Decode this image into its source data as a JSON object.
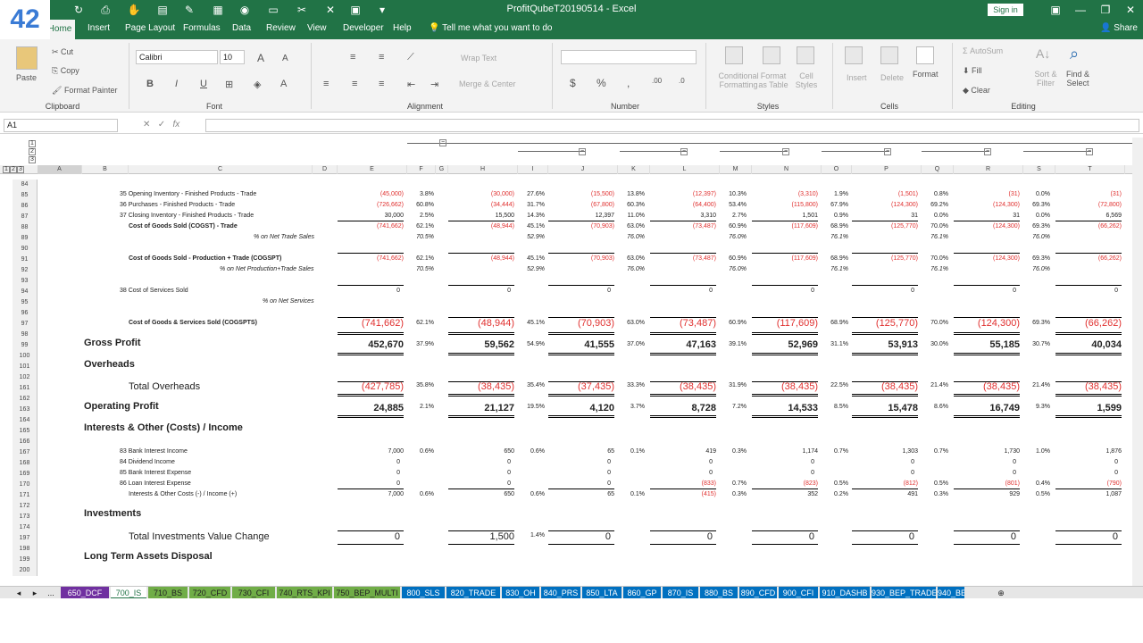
{
  "window": {
    "title": "ProfitQubeT20190514  -  Excel",
    "signin": "Sign in",
    "logo": "42"
  },
  "ribbon_tabs": [
    "Home",
    "Insert",
    "Page Layout",
    "Formulas",
    "Data",
    "Review",
    "View",
    "Developer",
    "Help"
  ],
  "tell_me": "Tell me what you want to do",
  "share": "Share",
  "clipboard": {
    "paste": "Paste",
    "cut": "Cut",
    "copy": "Copy",
    "format_painter": "Format Painter",
    "label": "Clipboard"
  },
  "font": {
    "name": "Calibri",
    "size": "10",
    "label": "Font"
  },
  "alignment": {
    "wrap": "Wrap Text",
    "merge": "Merge & Center",
    "label": "Alignment"
  },
  "number": {
    "label": "Number"
  },
  "styles": {
    "cond": "Conditional Formatting",
    "fmt_table": "Format as Table",
    "cell_styles": "Cell Styles",
    "label": "Styles"
  },
  "cells": {
    "insert": "Insert",
    "delete": "Delete",
    "format": "Format",
    "label": "Cells"
  },
  "editing": {
    "autosum": "AutoSum",
    "fill": "Fill",
    "clear": "Clear",
    "sort": "Sort & Filter",
    "find": "Find & Select",
    "label": "Editing"
  },
  "formula_bar": {
    "name_box": "A1",
    "fx": "fx",
    "value": ""
  },
  "outline_levels": [
    "1",
    "2",
    "3"
  ],
  "columns": [
    "A",
    "B",
    "C",
    "D",
    "E",
    "F",
    "G",
    "H",
    "I",
    "J",
    "K",
    "L",
    "M",
    "N",
    "O",
    "P",
    "Q",
    "R",
    "S",
    "T"
  ],
  "rows": [
    "84",
    "85",
    "86",
    "87",
    "88",
    "89",
    "90",
    "91",
    "92",
    "93",
    "94",
    "95",
    "96",
    "97",
    "98",
    "99",
    "100",
    "101",
    "102",
    "161",
    "162",
    "163",
    "164",
    "165",
    "166",
    "167",
    "168",
    "169",
    "170",
    "171",
    "172",
    "173",
    "174",
    "197",
    "198",
    "199",
    "200"
  ],
  "sheet": {
    "r85": {
      "label": "35  Opening Inventory - Finished Products - Trade",
      "v": [
        "(45,000)",
        "3.8%",
        "(30,000)",
        "27.6%",
        "(15,500)",
        "13.8%",
        "(12,397)",
        "10.3%",
        "(3,310)",
        "1.9%",
        "(1,501)",
        "0.8%",
        "(31)",
        "0.0%",
        "(31)"
      ]
    },
    "r86": {
      "label": "36  Purchases - Finished Products - Trade",
      "v": [
        "(726,662)",
        "60.8%",
        "(34,444)",
        "31.7%",
        "(67,800)",
        "60.3%",
        "(64,400)",
        "53.4%",
        "(115,800)",
        "67.9%",
        "(124,300)",
        "69.2%",
        "(124,300)",
        "69.3%",
        "(72,800)"
      ]
    },
    "r87": {
      "label": "37  Closing Inventory - Finished Products - Trade",
      "v": [
        "30,000",
        "2.5%",
        "15,500",
        "14.3%",
        "12,397",
        "11.0%",
        "3,310",
        "2.7%",
        "1,501",
        "0.9%",
        "31",
        "0.0%",
        "31",
        "0.0%",
        "6,569"
      ]
    },
    "r88": {
      "label": "Cost of Goods Sold  (COGST) - Trade",
      "v": [
        "(741,662)",
        "62.1%",
        "(48,944)",
        "45.1%",
        "(70,903)",
        "63.0%",
        "(73,487)",
        "60.9%",
        "(117,609)",
        "68.9%",
        "(125,770)",
        "70.0%",
        "(124,300)",
        "69.3%",
        "(66,262)"
      ]
    },
    "r89": {
      "label": "% on Net Trade Sales",
      "v": [
        "70.5%",
        "52.9%",
        "76.0%",
        "76.0%",
        "76.1%",
        "76.1%",
        "76.0%"
      ]
    },
    "r91": {
      "label": "Cost of Goods Sold - Production + Trade (COGSPT)",
      "v": [
        "(741,662)",
        "62.1%",
        "(48,944)",
        "45.1%",
        "(70,903)",
        "63.0%",
        "(73,487)",
        "60.9%",
        "(117,609)",
        "68.9%",
        "(125,770)",
        "70.0%",
        "(124,300)",
        "69.3%",
        "(66,262)"
      ]
    },
    "r92": {
      "label": "% on Net Production+Trade Sales",
      "v": [
        "70.5%",
        "52.9%",
        "76.0%",
        "76.0%",
        "76.1%",
        "76.1%",
        "76.0%"
      ]
    },
    "r94": {
      "label": "38  Cost of Services Sold",
      "v": [
        "0",
        "0",
        "0",
        "0",
        "0",
        "0",
        "0",
        "0"
      ]
    },
    "r95": {
      "label": "% on Net Services"
    },
    "r97": {
      "label": "Cost of Goods & Services Sold (COGSPTS)",
      "v": [
        "(741,662)",
        "62.1%",
        "(48,944)",
        "45.1%",
        "(70,903)",
        "63.0%",
        "(73,487)",
        "60.9%",
        "(117,609)",
        "68.9%",
        "(125,770)",
        "70.0%",
        "(124,300)",
        "69.3%",
        "(66,262)"
      ]
    },
    "r99": {
      "label": "Gross Profit",
      "v": [
        "452,670",
        "37.9%",
        "59,562",
        "54.9%",
        "41,555",
        "37.0%",
        "47,163",
        "39.1%",
        "52,969",
        "31.1%",
        "53,913",
        "30.0%",
        "55,185",
        "30.7%",
        "40,034"
      ]
    },
    "r101": {
      "label": "Overheads"
    },
    "r161": {
      "label": "Total Overheads",
      "v": [
        "(427,785)",
        "35.8%",
        "(38,435)",
        "35.4%",
        "(37,435)",
        "33.3%",
        "(38,435)",
        "31.9%",
        "(38,435)",
        "22.5%",
        "(38,435)",
        "21.4%",
        "(38,435)",
        "21.4%",
        "(38,435)"
      ]
    },
    "r163": {
      "label": "Operating Profit",
      "v": [
        "24,885",
        "2.1%",
        "21,127",
        "19.5%",
        "4,120",
        "3.7%",
        "8,728",
        "7.2%",
        "14,533",
        "8.5%",
        "15,478",
        "8.6%",
        "16,749",
        "9.3%",
        "1,599"
      ]
    },
    "r165": {
      "label": "Interests & Other (Costs) / Income"
    },
    "r167": {
      "label": "83  Bank Interest Income",
      "v": [
        "7,000",
        "0.6%",
        "650",
        "0.6%",
        "65",
        "0.1%",
        "419",
        "0.3%",
        "1,174",
        "0.7%",
        "1,303",
        "0.7%",
        "1,730",
        "1.0%",
        "1,876"
      ]
    },
    "r168": {
      "label": "84  Dividend Income",
      "v": [
        "0",
        "0",
        "0",
        "0",
        "0",
        "0",
        "0",
        "0"
      ]
    },
    "r169": {
      "label": "85  Bank Interest Expense",
      "v": [
        "0",
        "0",
        "0",
        "0",
        "0",
        "0",
        "0",
        "0"
      ]
    },
    "r170": {
      "label": "86  Loan Interest Expense",
      "v": [
        "0",
        "0",
        "0",
        "(833)",
        "0.7%",
        "(823)",
        "0.5%",
        "(812)",
        "0.5%",
        "(801)",
        "0.4%",
        "(790)"
      ]
    },
    "r171": {
      "label": "Interests & Other Costs (-) / Income (+)",
      "v": [
        "7,000",
        "0.6%",
        "650",
        "0.6%",
        "65",
        "0.1%",
        "(415)",
        "0.3%",
        "352",
        "0.2%",
        "491",
        "0.3%",
        "929",
        "0.5%",
        "1,087"
      ]
    },
    "r173": {
      "label": "Investments"
    },
    "r197": {
      "label": "Total Investments Value Change",
      "v": [
        "0",
        "1,500",
        "1.4%",
        "0",
        "0",
        "0",
        "0",
        "0",
        "0"
      ]
    },
    "r199": {
      "label": "Long Term Assets Disposal"
    }
  },
  "sheet_tabs": [
    "650_DCF",
    "700_IS",
    "710_BS",
    "720_CFD",
    "730_CFI",
    "740_RTS_KPI",
    "750_BEP_MULTI",
    "800_SLS",
    "820_TRADE",
    "830_OH",
    "840_PRS",
    "850_LTA",
    "860_GP",
    "870_IS",
    "880_BS",
    "890_CFD",
    "900_CFI",
    "910_DASHB",
    "930_BEP_TRADE",
    "940_BE"
  ],
  "colors": {
    "excel_green": "#217346",
    "negative": "#e0302f",
    "tab_purple": "#7030a0",
    "tab_green": "#70ad47",
    "tab_blue": "#0070c0"
  }
}
